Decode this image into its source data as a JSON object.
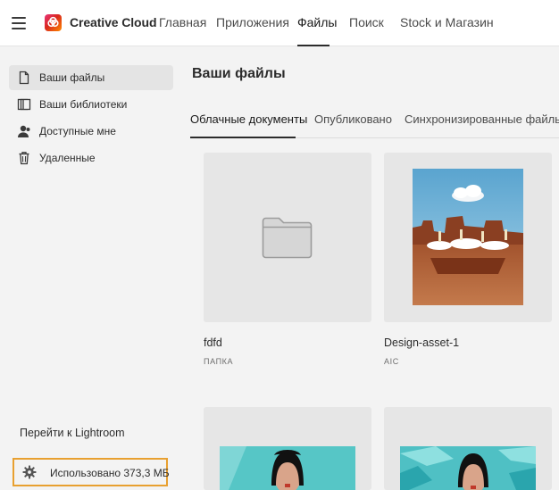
{
  "header": {
    "app_name": "Creative Cloud",
    "nav": [
      {
        "label": "Главная",
        "active": false
      },
      {
        "label": "Приложения",
        "active": false
      },
      {
        "label": "Файлы",
        "active": true
      },
      {
        "label": "Поиск",
        "active": false
      },
      {
        "label": "Stock и Магазин",
        "active": false
      }
    ]
  },
  "sidebar": {
    "items": [
      {
        "label": "Ваши файлы",
        "icon": "file-icon",
        "selected": true
      },
      {
        "label": "Ваши библиотеки",
        "icon": "library-icon",
        "selected": false
      },
      {
        "label": "Доступные мне",
        "icon": "shared-user-icon",
        "selected": false
      },
      {
        "label": "Удаленные",
        "icon": "trash-icon",
        "selected": false
      }
    ],
    "lightroom_link": "Перейти к Lightroom",
    "usage_label": "Использовано 373,3 МБ"
  },
  "main": {
    "title": "Ваши файлы",
    "tabs": [
      {
        "label": "Облачные документы",
        "active": true
      },
      {
        "label": "Опубликовано",
        "active": false
      },
      {
        "label": "Синхронизированные файлы",
        "active": false
      }
    ],
    "files": [
      {
        "name": "fdfd",
        "type": "ПАПКА",
        "thumbnail": "folder-icon"
      },
      {
        "name": "Design-asset-1",
        "type": "AIC",
        "thumbnail": "desert-rocks-image"
      },
      {
        "name": "",
        "type": "",
        "thumbnail": "woman-teal-image"
      },
      {
        "name": "",
        "type": "",
        "thumbnail": "woman-teal-ribbon-image"
      }
    ]
  },
  "colors": {
    "highlight_border": "#e8a030",
    "teal_background": "#56c6c6"
  }
}
